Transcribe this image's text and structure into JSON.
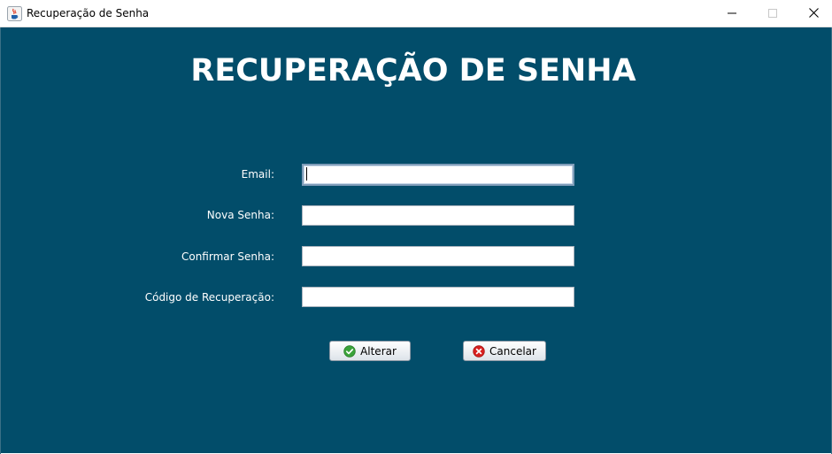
{
  "window": {
    "title": "Recuperação de Senha",
    "app_icon": "java-cup-icon",
    "controls": [
      "minimize-icon",
      "maximize-icon",
      "close-icon"
    ]
  },
  "heading": "RECUPERAÇÃO DE SENHA",
  "form": {
    "email_label": "Email:",
    "email_value": "",
    "new_password_label": "Nova Senha:",
    "new_password_value": "",
    "confirm_password_label": "Confirmar Senha:",
    "confirm_password_value": "",
    "recovery_code_label": "Código de Recuperação:",
    "recovery_code_value": ""
  },
  "buttons": {
    "confirm_label": "Alterar",
    "confirm_icon": "check-circle-icon",
    "cancel_label": "Cancelar",
    "cancel_icon": "x-circle-icon"
  },
  "colors": {
    "background": "#024d6a",
    "text": "#ffffff",
    "confirm_icon": "#3aa33a",
    "cancel_icon": "#d82020"
  }
}
